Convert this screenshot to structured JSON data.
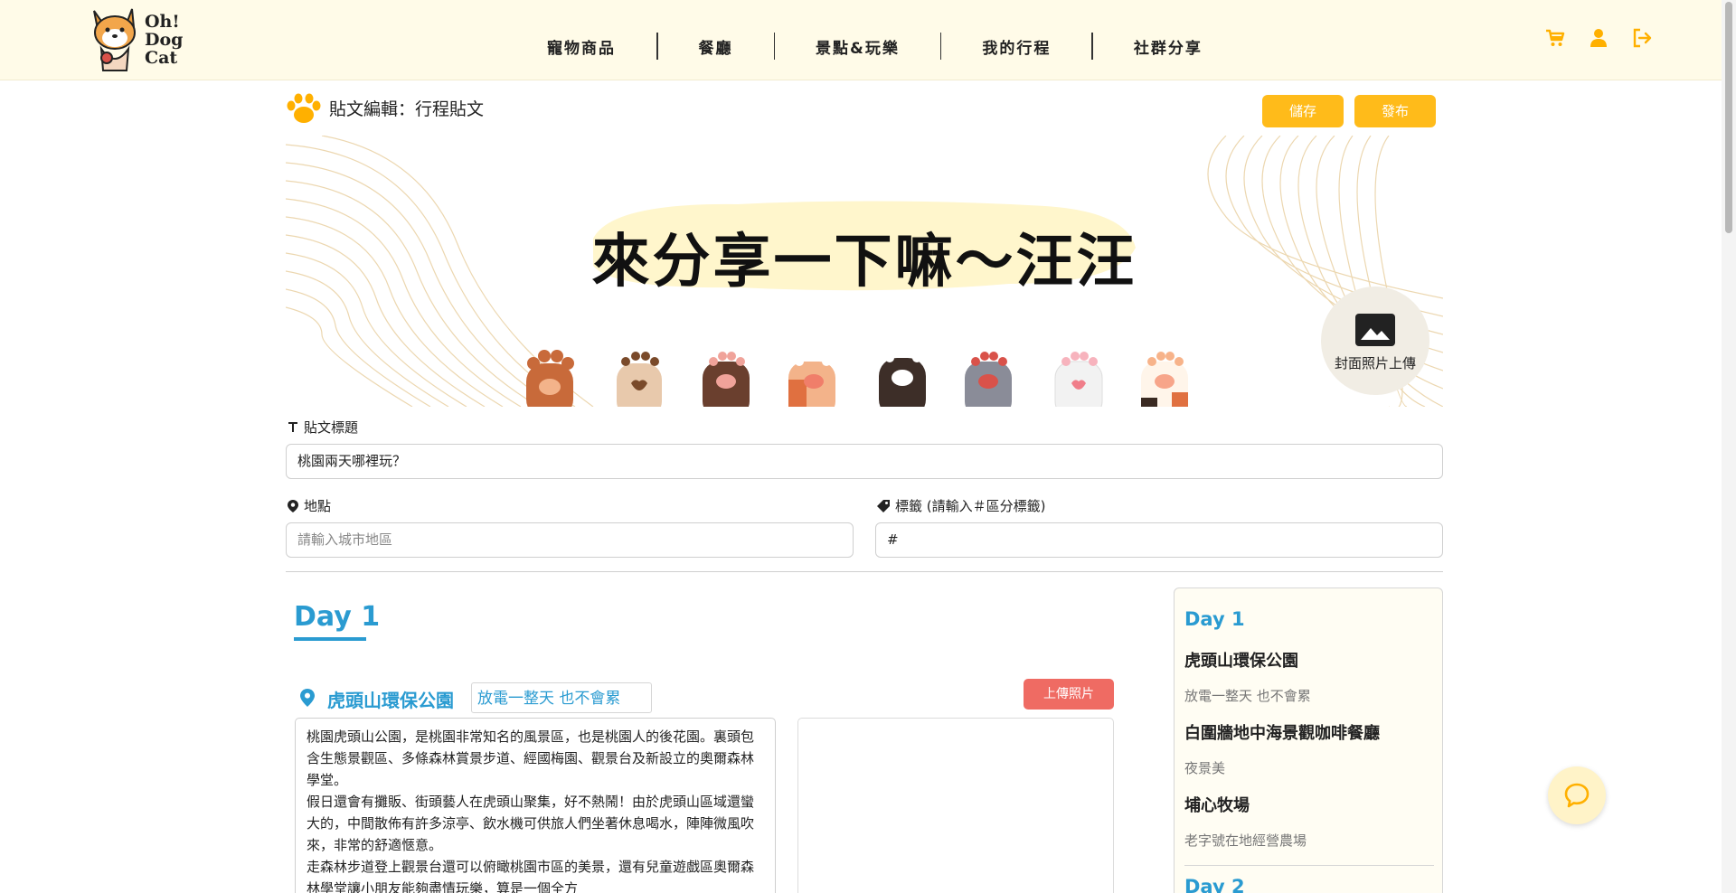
{
  "header": {
    "logo_text_line1": "Oh!",
    "logo_text_line2": "Dog",
    "logo_text_line3": "Cat",
    "nav": [
      "寵物商品",
      "餐廳",
      "景點&玩樂",
      "我的行程",
      "社群分享"
    ],
    "icons": [
      "cart-icon",
      "user-icon",
      "logout-icon"
    ],
    "accent_color": "#ffbb1a",
    "background_color": "#fffbe8"
  },
  "editor": {
    "page_title": "貼文編輯：行程貼文",
    "save_label": "儲存",
    "publish_label": "發布"
  },
  "banner": {
    "headline": "來分享一下嘛～汪汪",
    "cover_upload_label": "封面照片上傳"
  },
  "form": {
    "title_label": "貼文標題",
    "title_value": "桃園兩天哪裡玩？",
    "location_label": "地點",
    "location_placeholder": "請輸入城市地區",
    "tags_label": "標籤 (請輸入＃區分標籤)",
    "tags_value": "#"
  },
  "day1": {
    "heading": "Day 1",
    "spot_name": "虎頭山環保公園",
    "spot_subtitle": "放電一整天 也不會累",
    "upload_label": "上傳照片",
    "description": [
      "桃園虎頭山公園，是桃園非常知名的風景區，也是桃園人的後花園。裏頭包含生態景觀區、多條森林賞景步道、經國梅園、觀景台及新設立的奧爾森林學堂。",
      "假日還會有攤販、街頭藝人在虎頭山聚集，好不熱鬧！由於虎頭山區域還蠻大的，中間散佈有許多涼亭、飲水機可供旅人們坐著休息喝水，陣陣微風吹來，非常的舒適愜意。",
      "走森林步道登上觀景台還可以俯瞰桃園市區的美景，還有兒童遊戲區奧爾森林學堂讓小朋友能夠盡情玩樂，算是一個全方"
    ]
  },
  "sidebar": {
    "day1_label": "Day 1",
    "items": [
      {
        "name": "虎頭山環保公園",
        "note": "放電一整天 也不會累"
      },
      {
        "name": "白圍牆地中海景觀咖啡餐廳",
        "note": "夜景美"
      },
      {
        "name": "埔心牧場",
        "note": "老字號在地經營農場"
      }
    ],
    "day2_label": "Day 2"
  },
  "colors": {
    "blue": "#2a9bd1",
    "red_button": "#ef6b63"
  }
}
